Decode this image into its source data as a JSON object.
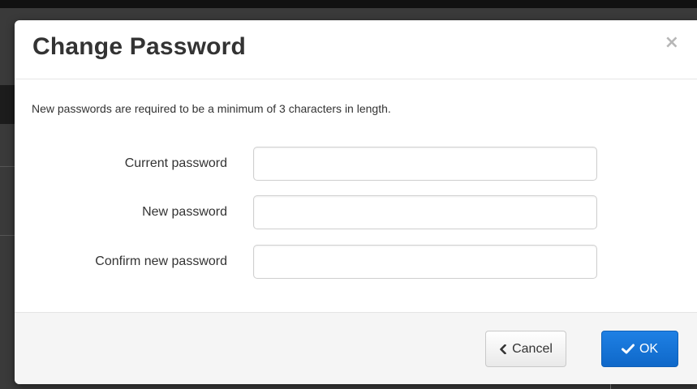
{
  "dialog": {
    "title": "Change Password",
    "close_glyph": "×",
    "info": "New passwords are required to be a minimum of 3 characters in length."
  },
  "form": {
    "fields": [
      {
        "label": "Current password",
        "value": "",
        "placeholder": ""
      },
      {
        "label": "New password",
        "value": "",
        "placeholder": ""
      },
      {
        "label": "Confirm new password",
        "value": "",
        "placeholder": ""
      }
    ]
  },
  "footer": {
    "cancel_label": "Cancel",
    "cancel_icon": "chevron-left-icon",
    "ok_label": "OK",
    "ok_icon": "checkmark-icon"
  },
  "colors": {
    "primary": "#1474d8",
    "overlay": "#3a3a3a"
  }
}
